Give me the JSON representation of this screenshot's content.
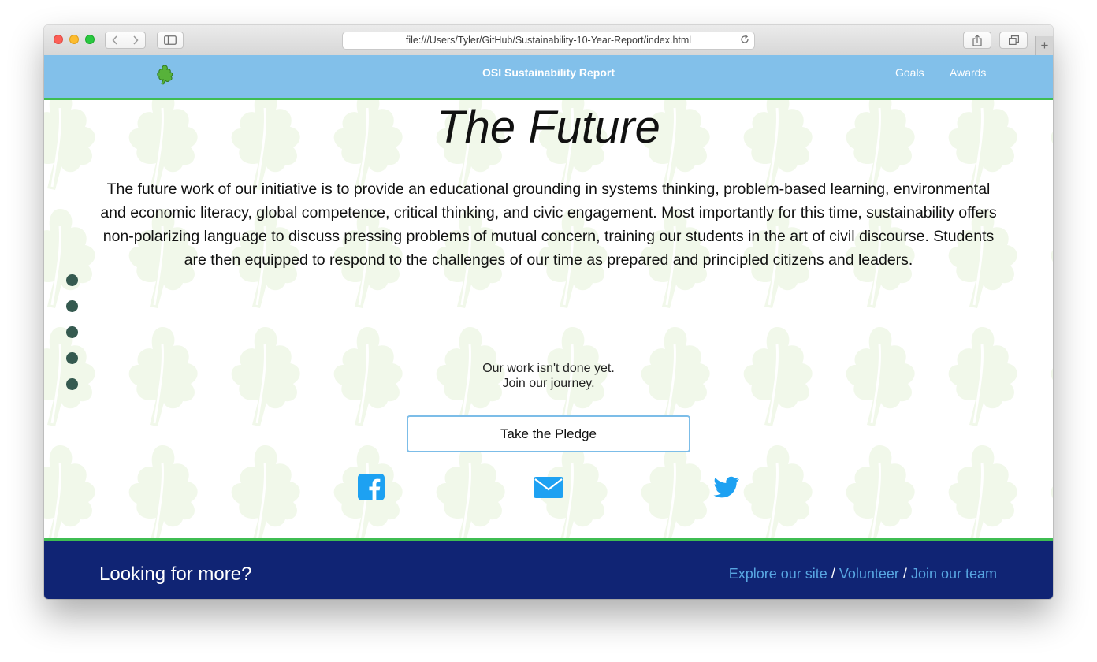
{
  "browser": {
    "url": "file:///Users/Tyler/GitHub/Sustainability-10-Year-Report/index.html",
    "back_icon": "chevron-left-icon",
    "forward_icon": "chevron-right-icon",
    "sidebar_icon": "sidebar-icon",
    "reload_icon": "reload-icon",
    "share_icon": "share-icon",
    "tabs_icon": "tabs-icon",
    "new_tab_label": "+"
  },
  "navbar": {
    "logo_icon": "oak-leaf-icon",
    "title": "OSI Sustainability Report",
    "links": [
      "Goals",
      "Awards"
    ],
    "background": "#82c0ea",
    "accent": "#3fbd52"
  },
  "main": {
    "heading": "The Future",
    "paragraph": "The future work of our initiative is to provide an educational grounding in systems thinking, problem-based learning, environmental and economic literacy, global competence, critical thinking, and civic engagement. Most importantly for this time, sustainability offers non-polarizing language to discuss pressing problems of mutual concern, training our students in the art of civil discourse. Students are then equipped to respond to the challenges of our time as prepared and principled citizens and leaders.",
    "cta_line1": "Our work isn't done yet.",
    "cta_line2": "Join our journey.",
    "pledge_button": "Take the Pledge",
    "social_icons": [
      "facebook-icon",
      "mail-icon",
      "twitter-icon"
    ],
    "social_color": "#1da1f2",
    "section_dots_count": 5,
    "dot_color": "#355a50"
  },
  "footer": {
    "title": "Looking for more?",
    "links": [
      "Explore our site",
      "Volunteer",
      "Join our team"
    ],
    "separator": "/",
    "background": "#102474",
    "link_color": "#58a6e2"
  }
}
